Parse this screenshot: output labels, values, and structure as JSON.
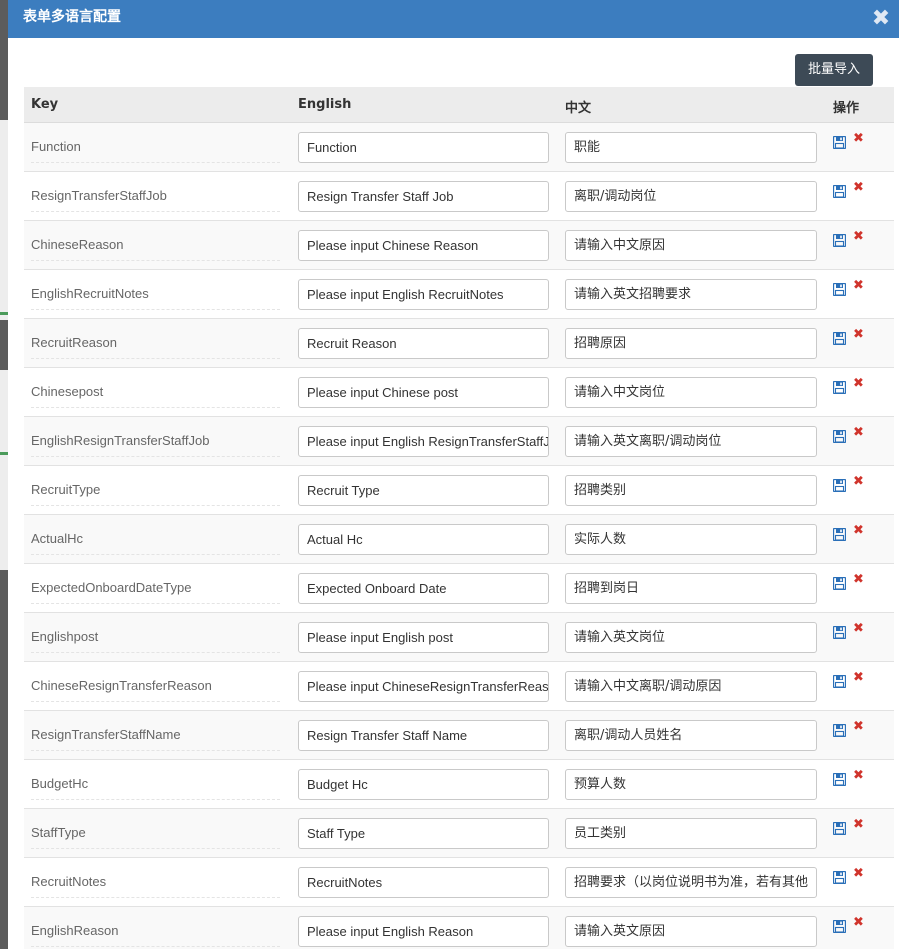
{
  "dialog": {
    "title": "表单多语言配置",
    "close_glyph": "✖",
    "import_label": "批量导入"
  },
  "table": {
    "headers": {
      "key": "Key",
      "english": "English",
      "chinese": "中文",
      "actions": "操作"
    },
    "rows": [
      {
        "key": "Function",
        "english": "Function",
        "chinese": "职能"
      },
      {
        "key": "ResignTransferStaffJob",
        "english": "Resign Transfer Staff Job",
        "chinese": "离职/调动岗位"
      },
      {
        "key": "ChineseReason",
        "english": "Please input Chinese Reason",
        "chinese": "请输入中文原因"
      },
      {
        "key": "EnglishRecruitNotes",
        "english": "Please input English RecruitNotes",
        "chinese": "请输入英文招聘要求"
      },
      {
        "key": "RecruitReason",
        "english": "Recruit Reason",
        "chinese": "招聘原因"
      },
      {
        "key": "Chinesepost",
        "english": "Please input Chinese post",
        "chinese": "请输入中文岗位"
      },
      {
        "key": "EnglishResignTransferStaffJob",
        "english": "Please input  English ResignTransferStaffJob",
        "chinese": "请输入英文离职/调动岗位"
      },
      {
        "key": "RecruitType",
        "english": "Recruit Type",
        "chinese": "招聘类别"
      },
      {
        "key": "ActualHc",
        "english": "Actual Hc",
        "chinese": "实际人数"
      },
      {
        "key": "ExpectedOnboardDateType",
        "english": "Expected Onboard Date",
        "chinese": "招聘到岗日"
      },
      {
        "key": "Englishpost",
        "english": "Please input English post",
        "chinese": "请输入英文岗位"
      },
      {
        "key": "ChineseResignTransferReason",
        "english": "Please input ChineseResignTransferReason",
        "chinese": "请输入中文离职/调动原因"
      },
      {
        "key": "ResignTransferStaffName",
        "english": "Resign Transfer Staff Name",
        "chinese": "离职/调动人员姓名"
      },
      {
        "key": "BudgetHc",
        "english": "Budget Hc",
        "chinese": "预算人数"
      },
      {
        "key": "StaffType",
        "english": "Staff Type",
        "chinese": "员工类别"
      },
      {
        "key": "RecruitNotes",
        "english": "RecruitNotes",
        "chinese": "招聘要求（以岗位说明书为准，若有其他"
      },
      {
        "key": "EnglishReason",
        "english": "Please input English Reason",
        "chinese": "请输入英文原因"
      }
    ]
  },
  "icons": {
    "save": "save-icon",
    "delete": "delete-icon",
    "delete_glyph": "✖",
    "save_color": "#2a6fb8",
    "delete_color": "#d0342c"
  },
  "colors": {
    "header_bar": "#3c7dbf",
    "import_button": "#3d4a56"
  }
}
